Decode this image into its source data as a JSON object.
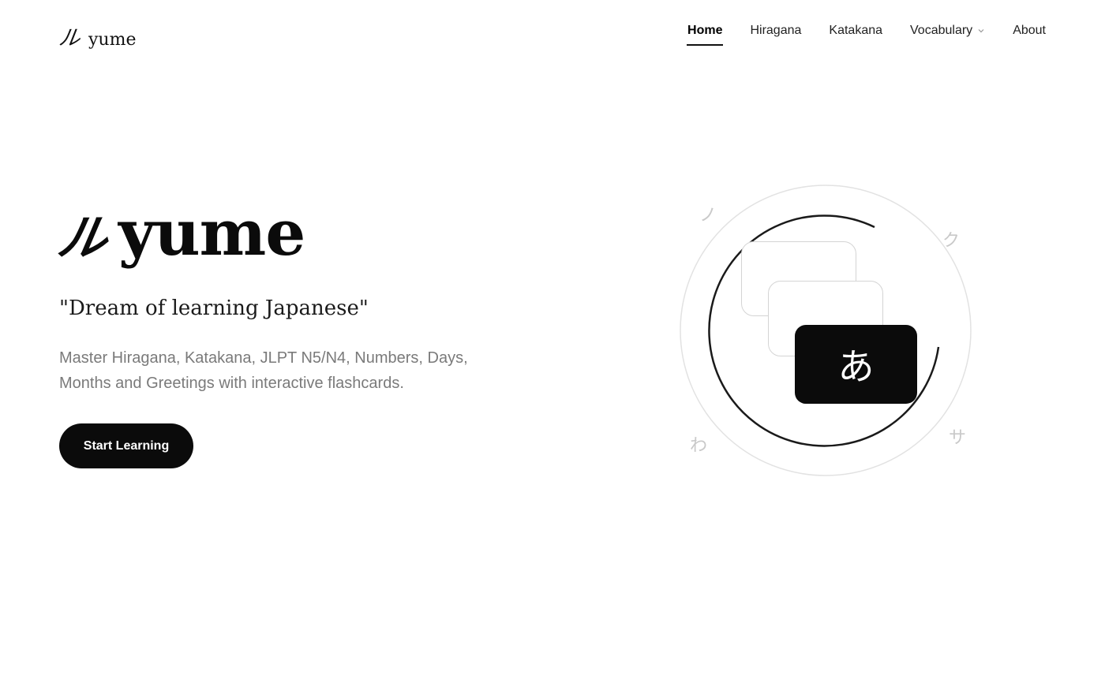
{
  "brand": {
    "mark": "ル",
    "name": "yume"
  },
  "nav": {
    "items": [
      {
        "label": "Home",
        "active": true
      },
      {
        "label": "Hiragana",
        "active": false
      },
      {
        "label": "Katakana",
        "active": false
      },
      {
        "label": "Vocabulary",
        "active": false,
        "dropdown": true
      },
      {
        "label": "About",
        "active": false
      }
    ]
  },
  "hero": {
    "mark": "ル",
    "title": "yume",
    "tagline": "\"Dream of learning Japanese\"",
    "description": "Master Hiragana, Katakana, JLPT N5/N4, Numbers, Days, Months and Greetings with interactive flashcards.",
    "cta_label": "Start Learning"
  },
  "illustration": {
    "front_card_char": "あ",
    "orbit_glyphs": {
      "top_left": "ノ",
      "top_right": "ク",
      "bottom_left": "わ",
      "bottom_right": "サ"
    }
  },
  "colors": {
    "primary": "#0b0b0b",
    "muted_text": "#7a7a7a",
    "glyph": "#c9c9c9",
    "card_border": "#d4d4d4"
  }
}
